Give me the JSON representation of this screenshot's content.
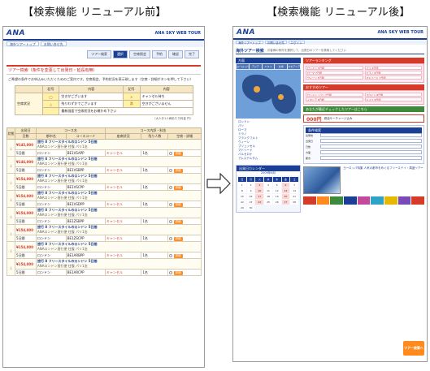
{
  "headings": {
    "before": "【検索機能 リニューアル前】",
    "after": "【検索機能 リニューアル後】"
  },
  "before": {
    "logo": "ANA",
    "brand_tour": "ANA SKY WEB TOUR",
    "subnav": [
      "海外ツアートップ",
      "お問い合せ先"
    ],
    "steps": [
      "ツアー検索",
      "選択",
      "空席照会",
      "予約",
      "確認",
      "完了"
    ],
    "section_title": "ツアー検索（条件を変更して出発日・延長有無）",
    "notice": "ご希望の条件でお申込みいただくためのご案内です。空席照会、予約状況を表示致します（空席・詳細ボタンを押して下さい）",
    "legend": {
      "headers": [
        "記号",
        "内容",
        "記号",
        "内容"
      ],
      "label": "空席状況",
      "rows": [
        [
          "◯",
          "空きがございます",
          "×",
          "キャンセル待ち"
        ],
        [
          "△",
          "残りわずかでございます",
          "満",
          "空きがございません"
        ],
        [
          "",
          "最新画面で空席状況をお確かめ下さい",
          "",
          ""
        ]
      ]
    },
    "legend_note": "（大人お1人様あたり料金 円）",
    "course_headers": {
      "status": "状態",
      "dep": "出発日",
      "days": "日数",
      "course": "コース名",
      "hotel": "都市名",
      "code": "コースコード",
      "price_head": "コース内訳・料金",
      "seat": "座席状況",
      "count": "残り人数",
      "detail": "空席・詳細"
    },
    "courses": [
      {
        "price": "¥145,000",
        "title": "旅行 8 フリースタイルのロンドン 5日間",
        "desc": "ANAロンドン直行便 往復 パリ1泊",
        "days": "5日間",
        "city": "ロンドン",
        "code": "BE1VSAPP",
        "seat": "キャンセル",
        "count": "1名"
      },
      {
        "price": "¥146,000",
        "title": "旅行 8 フリースタイルのロンドン 5日間",
        "desc": "ANAロンドン直行便 往復 パリ1泊",
        "days": "5日間",
        "city": "ロンドン",
        "code": "BE1VSBPP",
        "seat": "キャンセル",
        "count": "1名"
      },
      {
        "price": "¥154,000",
        "title": "旅行 8 フリースタイルのロンドン 5日間",
        "desc": "ANAロンドン直行便 往復 パリ1泊",
        "days": "5日間",
        "city": "ロンドン",
        "code": "BE1VSCPP",
        "seat": "キャンセル",
        "count": "1名"
      },
      {
        "price": "¥154,000",
        "title": "旅行 8 フリースタイルのロンドン 5日間",
        "desc": "ANAロンドン直行便 往復 パリ1泊",
        "days": "5日間",
        "city": "ロンドン",
        "code": "BE1VSDPP",
        "seat": "キャンセル",
        "count": "1名"
      },
      {
        "price": "¥154,000",
        "title": "旅行 8 フリースタイルのロンドン 5日間",
        "desc": "ANAロンドン直行便 往復 パリ1泊",
        "days": "5日間",
        "city": "ロンドン",
        "code": "BE1ZSBPP",
        "seat": "キャンセル",
        "count": "1名"
      },
      {
        "price": "¥154,000",
        "title": "旅行 8 フリースタイルのロンドン 5日間",
        "desc": "ANAロンドン直行便 往復 パリ1泊",
        "days": "5日間",
        "city": "ロンドン",
        "code": "BE1ZSCPP",
        "seat": "キャンセル",
        "count": "1名"
      },
      {
        "price": "¥154,000",
        "title": "旅行 8 フリースタイルのロンドン 5日間",
        "desc": "ANAロンドン直行便 往復 パリ1泊",
        "days": "5日間",
        "city": "ロンドン",
        "code": "BE1ARBPP",
        "seat": "キャンセル",
        "count": "1名"
      },
      {
        "price": "¥154,000",
        "title": "旅行 8 フリースタイルのロンドン 5日間",
        "desc": "ANAロンドン直行便 往復 パリ1泊",
        "days": "5日間",
        "city": "ロンドン",
        "code": "BE1ARCPP",
        "seat": "キャンセル",
        "count": "1名"
      }
    ],
    "detail_button": "詳細"
  },
  "after": {
    "logo": "ANA",
    "brand_tour": "ANA SKY WEB TOUR",
    "subnav": [
      "海外ツアートップ",
      "お問い合せ先",
      "ログイン"
    ],
    "title": "海外ツアー検索",
    "title_sub": "お客様の条件を選択して、出発日のツアーを検索してください",
    "region_box": "方面",
    "region_tabs": [
      "ヨーロッパ",
      "アジア",
      "ハワイ",
      "北米",
      "オセアニア"
    ],
    "region_links": [
      "ロンドン",
      "パリ",
      "ローマ",
      "ミラノ",
      "フランクフルト",
      "ウィーン",
      "ブリュッセル",
      "マドリード",
      "バルセロナ",
      "アムステルダム"
    ],
    "calendar_title": "出発日カレンダー",
    "calendar_month": "2009年6月",
    "weekdays": [
      "日",
      "月",
      "火",
      "水",
      "木",
      "金",
      "土"
    ],
    "ranking_title": "ツアーランキング",
    "ranking_items": [
      "ロンドン 5日間",
      "パリ 6日間",
      "ローマ 7日間",
      "ミラノ 6日間",
      "ウィーン 5日間",
      "マドリード 7日間"
    ],
    "osusume_title": "おすすめツアー",
    "osusume_items": [
      "ロンドン・パリ 7日間",
      "スペイン 8日間",
      "イタリア 8日間",
      "ドイツ 6日間"
    ],
    "recent_title": "あなたが最近チェックしたツアーはこちら",
    "promo_price": "000円",
    "promo_text": "燃油サーチャージ込み",
    "search_title": "条件検索",
    "search_fields": [
      "出発地",
      "出発日",
      "日数",
      "方面",
      "都市"
    ],
    "feature_text": "ヨーロッパ特集 人気の都市をめぐるフリーステイ・周遊ツアー",
    "go_button": "ツアー検索へ"
  }
}
